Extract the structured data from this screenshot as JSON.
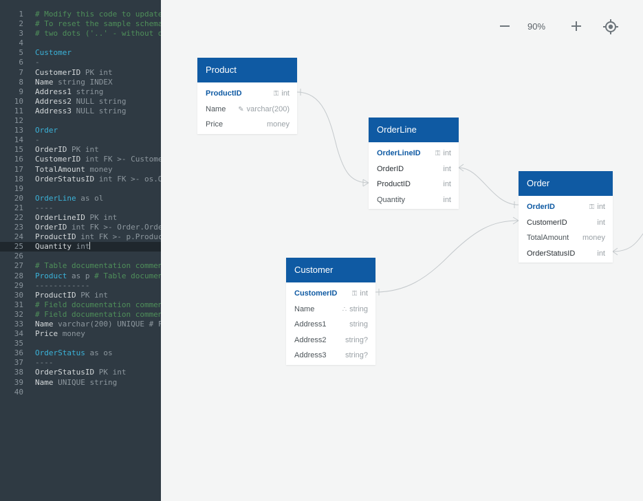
{
  "editor": {
    "current_line": 25,
    "lines": [
      {
        "n": "1",
        "parts": [
          {
            "t": "# Modify this code to update",
            "c": "cm"
          }
        ]
      },
      {
        "n": "2",
        "parts": [
          {
            "t": "# To reset the sample schema",
            "c": "cm"
          }
        ]
      },
      {
        "n": "3",
        "parts": [
          {
            "t": "# two dots ('..' - without q",
            "c": "cm"
          }
        ]
      },
      {
        "n": "4",
        "parts": []
      },
      {
        "n": "5",
        "parts": [
          {
            "t": "Customer",
            "c": "tn"
          }
        ]
      },
      {
        "n": "6",
        "parts": [
          {
            "t": "-",
            "c": "dl"
          }
        ]
      },
      {
        "n": "7",
        "parts": [
          {
            "t": "CustomerID ",
            "c": "cd"
          },
          {
            "t": "PK int",
            "c": "kw"
          }
        ]
      },
      {
        "n": "8",
        "parts": [
          {
            "t": "Name ",
            "c": "cd"
          },
          {
            "t": "string INDEX",
            "c": "kw"
          }
        ]
      },
      {
        "n": "9",
        "parts": [
          {
            "t": "Address1 ",
            "c": "cd"
          },
          {
            "t": "string",
            "c": "kw"
          }
        ]
      },
      {
        "n": "10",
        "parts": [
          {
            "t": "Address2 ",
            "c": "cd"
          },
          {
            "t": "NULL string",
            "c": "kw"
          }
        ]
      },
      {
        "n": "11",
        "parts": [
          {
            "t": "Address3 ",
            "c": "cd"
          },
          {
            "t": "NULL string",
            "c": "kw"
          }
        ]
      },
      {
        "n": "12",
        "parts": []
      },
      {
        "n": "13",
        "parts": [
          {
            "t": "Order",
            "c": "tn"
          }
        ]
      },
      {
        "n": "14",
        "parts": [
          {
            "t": "-",
            "c": "dl"
          }
        ]
      },
      {
        "n": "15",
        "parts": [
          {
            "t": "OrderID ",
            "c": "cd"
          },
          {
            "t": "PK int",
            "c": "kw"
          }
        ]
      },
      {
        "n": "16",
        "parts": [
          {
            "t": "CustomerID ",
            "c": "cd"
          },
          {
            "t": "int FK >- Custome",
            "c": "kw"
          }
        ]
      },
      {
        "n": "17",
        "parts": [
          {
            "t": "TotalAmount ",
            "c": "cd"
          },
          {
            "t": "money",
            "c": "kw"
          }
        ]
      },
      {
        "n": "18",
        "parts": [
          {
            "t": "OrderStatusID ",
            "c": "cd"
          },
          {
            "t": "int FK >- os.O",
            "c": "kw"
          }
        ]
      },
      {
        "n": "19",
        "parts": []
      },
      {
        "n": "20",
        "parts": [
          {
            "t": "OrderLine",
            "c": "tn"
          },
          {
            "t": " as ol",
            "c": "kw"
          }
        ]
      },
      {
        "n": "21",
        "parts": [
          {
            "t": "----",
            "c": "dl"
          }
        ]
      },
      {
        "n": "22",
        "parts": [
          {
            "t": "OrderLineID ",
            "c": "cd"
          },
          {
            "t": "PK int",
            "c": "kw"
          }
        ]
      },
      {
        "n": "23",
        "parts": [
          {
            "t": "OrderID ",
            "c": "cd"
          },
          {
            "t": "int FK >- Order.Orde",
            "c": "kw"
          }
        ]
      },
      {
        "n": "24",
        "parts": [
          {
            "t": "ProductID ",
            "c": "cd"
          },
          {
            "t": "int FK >- p.Produc",
            "c": "kw"
          }
        ]
      },
      {
        "n": "25",
        "parts": [
          {
            "t": "Quantity ",
            "c": "cd"
          },
          {
            "t": "int",
            "c": "kw"
          }
        ]
      },
      {
        "n": "26",
        "parts": []
      },
      {
        "n": "27",
        "parts": [
          {
            "t": "# Table documentation commen",
            "c": "cm"
          }
        ]
      },
      {
        "n": "28",
        "parts": [
          {
            "t": "Product",
            "c": "tn"
          },
          {
            "t": " as p ",
            "c": "kw"
          },
          {
            "t": "# Table documen",
            "c": "cm"
          }
        ]
      },
      {
        "n": "29",
        "parts": [
          {
            "t": "------------",
            "c": "dl"
          }
        ]
      },
      {
        "n": "30",
        "parts": [
          {
            "t": "ProductID ",
            "c": "cd"
          },
          {
            "t": "PK int",
            "c": "kw"
          }
        ]
      },
      {
        "n": "31",
        "parts": [
          {
            "t": "# Field documentation commen",
            "c": "cm"
          }
        ]
      },
      {
        "n": "32",
        "parts": [
          {
            "t": "# Field documentation commen",
            "c": "cm"
          }
        ]
      },
      {
        "n": "33",
        "parts": [
          {
            "t": "Name ",
            "c": "cd"
          },
          {
            "t": "varchar(200) UNIQUE # F",
            "c": "kw"
          }
        ]
      },
      {
        "n": "34",
        "parts": [
          {
            "t": "Price ",
            "c": "cd"
          },
          {
            "t": "money",
            "c": "kw"
          }
        ]
      },
      {
        "n": "35",
        "parts": []
      },
      {
        "n": "36",
        "parts": [
          {
            "t": "OrderStatus",
            "c": "tn"
          },
          {
            "t": " as os",
            "c": "kw"
          }
        ]
      },
      {
        "n": "37",
        "parts": [
          {
            "t": "----",
            "c": "dl"
          }
        ]
      },
      {
        "n": "38",
        "parts": [
          {
            "t": "OrderStatusID ",
            "c": "cd"
          },
          {
            "t": "PK int",
            "c": "kw"
          }
        ]
      },
      {
        "n": "39",
        "parts": [
          {
            "t": "Name ",
            "c": "cd"
          },
          {
            "t": "UNIQUE string",
            "c": "kw"
          }
        ]
      },
      {
        "n": "40",
        "parts": []
      }
    ]
  },
  "toolbar": {
    "zoom_level": "90%"
  },
  "colors": {
    "header": "#0f5aa3",
    "editor_bg": "#2f3a43",
    "canvas_bg": "#f4f5f5"
  },
  "tables": [
    {
      "id": "t-product",
      "name": "Product",
      "fields": [
        {
          "name": "ProductID",
          "type": "int",
          "kind": "pk",
          "icon": "key-icon"
        },
        {
          "name": "Name",
          "type": "varchar(200)",
          "kind": "normal",
          "icon": "wrench-icon"
        },
        {
          "name": "Price",
          "type": "money",
          "kind": "normal",
          "icon": ""
        }
      ]
    },
    {
      "id": "t-orderline",
      "name": "OrderLine",
      "fields": [
        {
          "name": "OrderLineID",
          "type": "int",
          "kind": "pk",
          "icon": "key-icon"
        },
        {
          "name": "OrderID",
          "type": "int",
          "kind": "fk",
          "icon": ""
        },
        {
          "name": "ProductID",
          "type": "int",
          "kind": "fk",
          "icon": ""
        },
        {
          "name": "Quantity",
          "type": "int",
          "kind": "normal",
          "icon": ""
        }
      ]
    },
    {
      "id": "t-order",
      "name": "Order",
      "fields": [
        {
          "name": "OrderID",
          "type": "int",
          "kind": "pk",
          "icon": "key-icon"
        },
        {
          "name": "CustomerID",
          "type": "int",
          "kind": "fk",
          "icon": ""
        },
        {
          "name": "TotalAmount",
          "type": "money",
          "kind": "normal",
          "icon": ""
        },
        {
          "name": "OrderStatusID",
          "type": "int",
          "kind": "fk",
          "icon": ""
        }
      ]
    },
    {
      "id": "t-customer",
      "name": "Customer",
      "fields": [
        {
          "name": "CustomerID",
          "type": "int",
          "kind": "pk",
          "icon": "key-icon"
        },
        {
          "name": "Name",
          "type": "string",
          "kind": "normal",
          "icon": "index-icon"
        },
        {
          "name": "Address1",
          "type": "string",
          "kind": "normal",
          "icon": ""
        },
        {
          "name": "Address2",
          "type": "string?",
          "kind": "normal",
          "icon": ""
        },
        {
          "name": "Address3",
          "type": "string?",
          "kind": "normal",
          "icon": ""
        }
      ]
    }
  ]
}
